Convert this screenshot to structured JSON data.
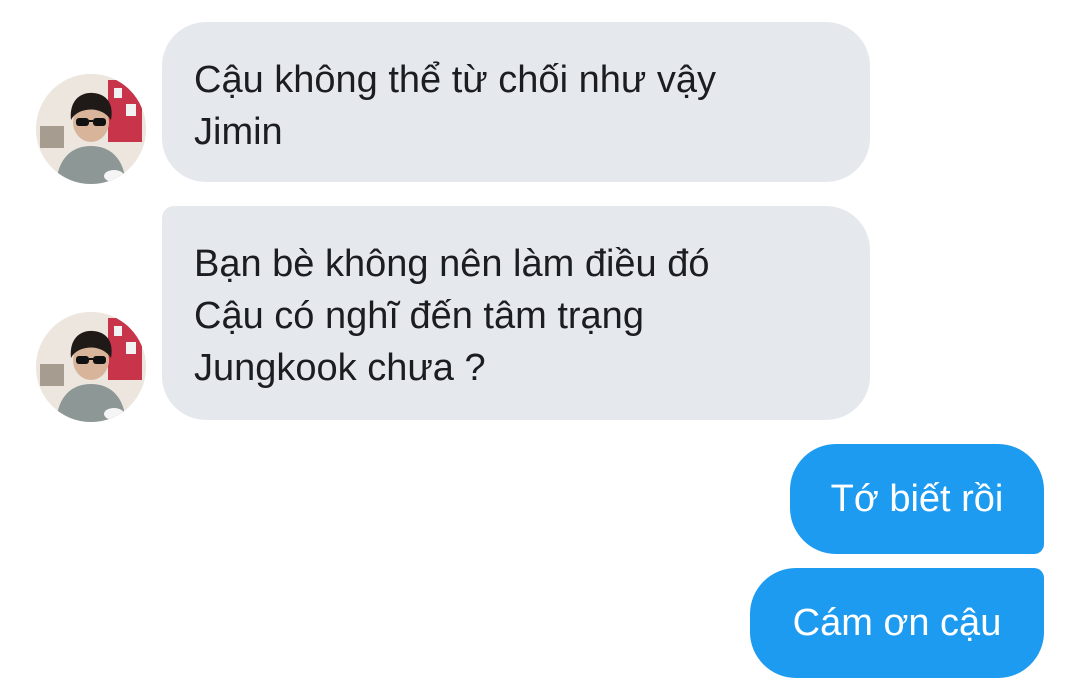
{
  "conversation": {
    "messages": [
      {
        "direction": "incoming",
        "text": "Cậu không thể từ chối như vậy\nJimin",
        "avatar_icon": "user-avatar-icon"
      },
      {
        "direction": "incoming",
        "text": "Bạn bè không nên làm điều đó\nCậu có nghĩ đến tâm trạng\nJungkook chưa ?",
        "avatar_icon": "user-avatar-icon"
      },
      {
        "direction": "outgoing",
        "text": "Tớ biết rồi"
      },
      {
        "direction": "outgoing",
        "text": "Cám ơn cậu"
      }
    ]
  },
  "colors": {
    "incoming_bubble": "#e5e9ee",
    "incoming_text": "#1b1d20",
    "outgoing_bubble": "#1d9bf0",
    "outgoing_text": "#ffffff",
    "background": "#ffffff"
  }
}
